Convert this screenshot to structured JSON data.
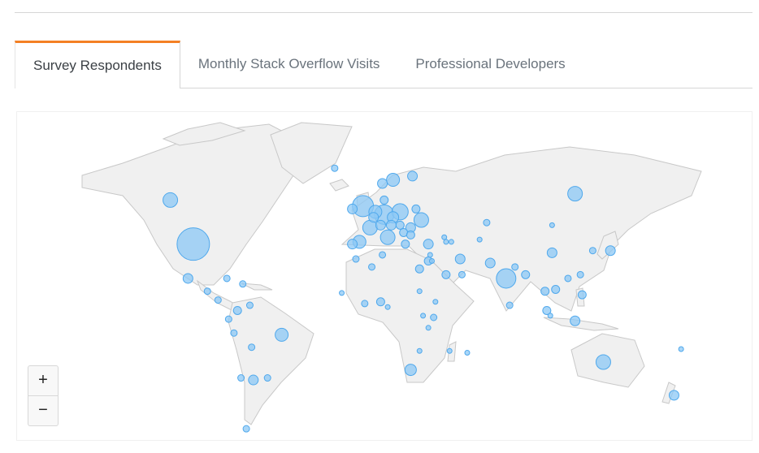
{
  "tabs": [
    {
      "label": "Survey Respondents",
      "active": true
    },
    {
      "label": "Monthly Stack Overflow Visits",
      "active": false
    },
    {
      "label": "Professional Developers",
      "active": false
    }
  ],
  "map": {
    "zoom_in_label": "+",
    "zoom_out_label": "−",
    "colors": {
      "land": "#f0f0f0",
      "border": "#c8c8c8",
      "bubble_fill": "#8cc8f5",
      "bubble_stroke": "#4fa8ec"
    },
    "bubbles": [
      {
        "country": "United States",
        "lat": 39,
        "lon": -98,
        "size": 20
      },
      {
        "country": "Canada",
        "lat": 56,
        "lon": -111,
        "size": 9
      },
      {
        "country": "Mexico",
        "lat": 22,
        "lon": -101,
        "size": 6
      },
      {
        "country": "Cuba",
        "lat": 22,
        "lon": -79,
        "size": 4
      },
      {
        "country": "Guatemala",
        "lat": 15,
        "lon": -90,
        "size": 4
      },
      {
        "country": "Costa Rica",
        "lat": 10,
        "lon": -84,
        "size": 4
      },
      {
        "country": "Dominican Republic",
        "lat": 19,
        "lon": -70,
        "size": 4
      },
      {
        "country": "Colombia",
        "lat": 4,
        "lon": -73,
        "size": 5
      },
      {
        "country": "Venezuela",
        "lat": 7,
        "lon": -66,
        "size": 4
      },
      {
        "country": "Ecuador",
        "lat": -1,
        "lon": -78,
        "size": 4
      },
      {
        "country": "Peru",
        "lat": -9,
        "lon": -75,
        "size": 4
      },
      {
        "country": "Brazil",
        "lat": -10,
        "lon": -48,
        "size": 8
      },
      {
        "country": "Bolivia",
        "lat": -17,
        "lon": -65,
        "size": 4
      },
      {
        "country": "Chile",
        "lat": -33,
        "lon": -71,
        "size": 4
      },
      {
        "country": "Argentina",
        "lat": -34,
        "lon": -64,
        "size": 6
      },
      {
        "country": "Uruguay",
        "lat": -33,
        "lon": -56,
        "size": 4
      },
      {
        "country": "Tierra del Fuego",
        "lat": -54,
        "lon": -68,
        "size": 4
      },
      {
        "country": "Iceland",
        "lat": 65,
        "lon": -18,
        "size": 4
      },
      {
        "country": "United Kingdom",
        "lat": 54,
        "lon": -2,
        "size": 13
      },
      {
        "country": "Ireland",
        "lat": 53,
        "lon": -8,
        "size": 6
      },
      {
        "country": "France",
        "lat": 46,
        "lon": 2,
        "size": 9
      },
      {
        "country": "Spain",
        "lat": 40,
        "lon": -4,
        "size": 8
      },
      {
        "country": "Portugal",
        "lat": 39,
        "lon": -8,
        "size": 6
      },
      {
        "country": "Belgium",
        "lat": 50,
        "lon": 4,
        "size": 6
      },
      {
        "country": "Netherlands",
        "lat": 52,
        "lon": 5,
        "size": 8
      },
      {
        "country": "Germany",
        "lat": 51,
        "lon": 10,
        "size": 12
      },
      {
        "country": "Switzerland",
        "lat": 47,
        "lon": 8,
        "size": 6
      },
      {
        "country": "Denmark",
        "lat": 56,
        "lon": 10,
        "size": 5
      },
      {
        "country": "Norway",
        "lat": 61,
        "lon": 9,
        "size": 6
      },
      {
        "country": "Sweden",
        "lat": 62,
        "lon": 15,
        "size": 8
      },
      {
        "country": "Finland",
        "lat": 63,
        "lon": 26,
        "size": 6
      },
      {
        "country": "Italy",
        "lat": 42,
        "lon": 12,
        "size": 9
      },
      {
        "country": "Austria",
        "lat": 47,
        "lon": 14,
        "size": 6
      },
      {
        "country": "Czech Republic",
        "lat": 50,
        "lon": 15,
        "size": 7
      },
      {
        "country": "Poland",
        "lat": 52,
        "lon": 19,
        "size": 10
      },
      {
        "country": "Hungary",
        "lat": 47,
        "lon": 19,
        "size": 5
      },
      {
        "country": "Serbia",
        "lat": 44,
        "lon": 21,
        "size": 5
      },
      {
        "country": "Romania",
        "lat": 46,
        "lon": 25,
        "size": 6
      },
      {
        "country": "Bulgaria",
        "lat": 43,
        "lon": 25,
        "size": 5
      },
      {
        "country": "Greece",
        "lat": 39,
        "lon": 22,
        "size": 5
      },
      {
        "country": "Belarus",
        "lat": 53,
        "lon": 28,
        "size": 5
      },
      {
        "country": "Ukraine",
        "lat": 49,
        "lon": 31,
        "size": 9
      },
      {
        "country": "Russia",
        "lat": 58,
        "lon": 118,
        "size": 9
      },
      {
        "country": "Turkey",
        "lat": 39,
        "lon": 35,
        "size": 6
      },
      {
        "country": "Georgia",
        "lat": 42,
        "lon": 44,
        "size": 3
      },
      {
        "country": "Armenia",
        "lat": 40,
        "lon": 45,
        "size": 3
      },
      {
        "country": "Azerbaijan",
        "lat": 40,
        "lon": 48,
        "size": 3
      },
      {
        "country": "Lebanon",
        "lat": 34,
        "lon": 36,
        "size": 3
      },
      {
        "country": "Israel",
        "lat": 31,
        "lon": 35,
        "size": 5
      },
      {
        "country": "Jordan",
        "lat": 31,
        "lon": 37,
        "size": 3
      },
      {
        "country": "Egypt",
        "lat": 27,
        "lon": 30,
        "size": 5
      },
      {
        "country": "Saudi Arabia",
        "lat": 24,
        "lon": 45,
        "size": 5
      },
      {
        "country": "United Arab Emirates",
        "lat": 24,
        "lon": 54,
        "size": 4
      },
      {
        "country": "Iran",
        "lat": 32,
        "lon": 53,
        "size": 6
      },
      {
        "country": "Kazakhstan",
        "lat": 48,
        "lon": 68,
        "size": 4
      },
      {
        "country": "Uzbekistan",
        "lat": 41,
        "lon": 64,
        "size": 3
      },
      {
        "country": "Pakistan",
        "lat": 30,
        "lon": 70,
        "size": 6
      },
      {
        "country": "India",
        "lat": 22,
        "lon": 79,
        "size": 12
      },
      {
        "country": "Nepal",
        "lat": 28,
        "lon": 84,
        "size": 4
      },
      {
        "country": "Bangladesh",
        "lat": 24,
        "lon": 90,
        "size": 5
      },
      {
        "country": "Sri Lanka",
        "lat": 7,
        "lon": 81,
        "size": 4
      },
      {
        "country": "China",
        "lat": 35,
        "lon": 105,
        "size": 6
      },
      {
        "country": "Mongolia",
        "lat": 47,
        "lon": 105,
        "size": 3
      },
      {
        "country": "South Korea",
        "lat": 36,
        "lon": 128,
        "size": 4
      },
      {
        "country": "Japan",
        "lat": 36,
        "lon": 138,
        "size": 6
      },
      {
        "country": "Taiwan",
        "lat": 24,
        "lon": 121,
        "size": 4
      },
      {
        "country": "Hong Kong",
        "lat": 22,
        "lon": 114,
        "size": 4
      },
      {
        "country": "Vietnam",
        "lat": 16,
        "lon": 107,
        "size": 5
      },
      {
        "country": "Thailand",
        "lat": 15,
        "lon": 101,
        "size": 5
      },
      {
        "country": "Philippines",
        "lat": 13,
        "lon": 122,
        "size": 5
      },
      {
        "country": "Malaysia",
        "lat": 4,
        "lon": 102,
        "size": 5
      },
      {
        "country": "Singapore",
        "lat": 1,
        "lon": 104,
        "size": 3
      },
      {
        "country": "Indonesia",
        "lat": -2,
        "lon": 118,
        "size": 6
      },
      {
        "country": "Australia",
        "lat": -25,
        "lon": 134,
        "size": 9
      },
      {
        "country": "New Zealand",
        "lat": -41,
        "lon": 174,
        "size": 6
      },
      {
        "country": "Fiji",
        "lat": -18,
        "lon": 178,
        "size": 3
      },
      {
        "country": "Morocco",
        "lat": 32,
        "lon": -6,
        "size": 4
      },
      {
        "country": "Algeria",
        "lat": 28,
        "lon": 3,
        "size": 4
      },
      {
        "country": "Tunisia",
        "lat": 34,
        "lon": 9,
        "size": 4
      },
      {
        "country": "Senegal",
        "lat": 14,
        "lon": -14,
        "size": 3
      },
      {
        "country": "Ghana",
        "lat": 8,
        "lon": -1,
        "size": 4
      },
      {
        "country": "Nigeria",
        "lat": 9,
        "lon": 8,
        "size": 5
      },
      {
        "country": "Cameroon",
        "lat": 6,
        "lon": 12,
        "size": 3
      },
      {
        "country": "Sudan",
        "lat": 15,
        "lon": 30,
        "size": 3
      },
      {
        "country": "Ethiopia",
        "lat": 9,
        "lon": 39,
        "size": 3
      },
      {
        "country": "Uganda",
        "lat": 1,
        "lon": 32,
        "size": 3
      },
      {
        "country": "Kenya",
        "lat": 0,
        "lon": 38,
        "size": 4
      },
      {
        "country": "Tanzania",
        "lat": -6,
        "lon": 35,
        "size": 3
      },
      {
        "country": "Zimbabwe",
        "lat": -19,
        "lon": 30,
        "size": 3
      },
      {
        "country": "South Africa",
        "lat": -29,
        "lon": 25,
        "size": 7
      },
      {
        "country": "Madagascar",
        "lat": -19,
        "lon": 47,
        "size": 3
      },
      {
        "country": "Mauritius",
        "lat": -20,
        "lon": 57,
        "size": 3
      }
    ]
  }
}
